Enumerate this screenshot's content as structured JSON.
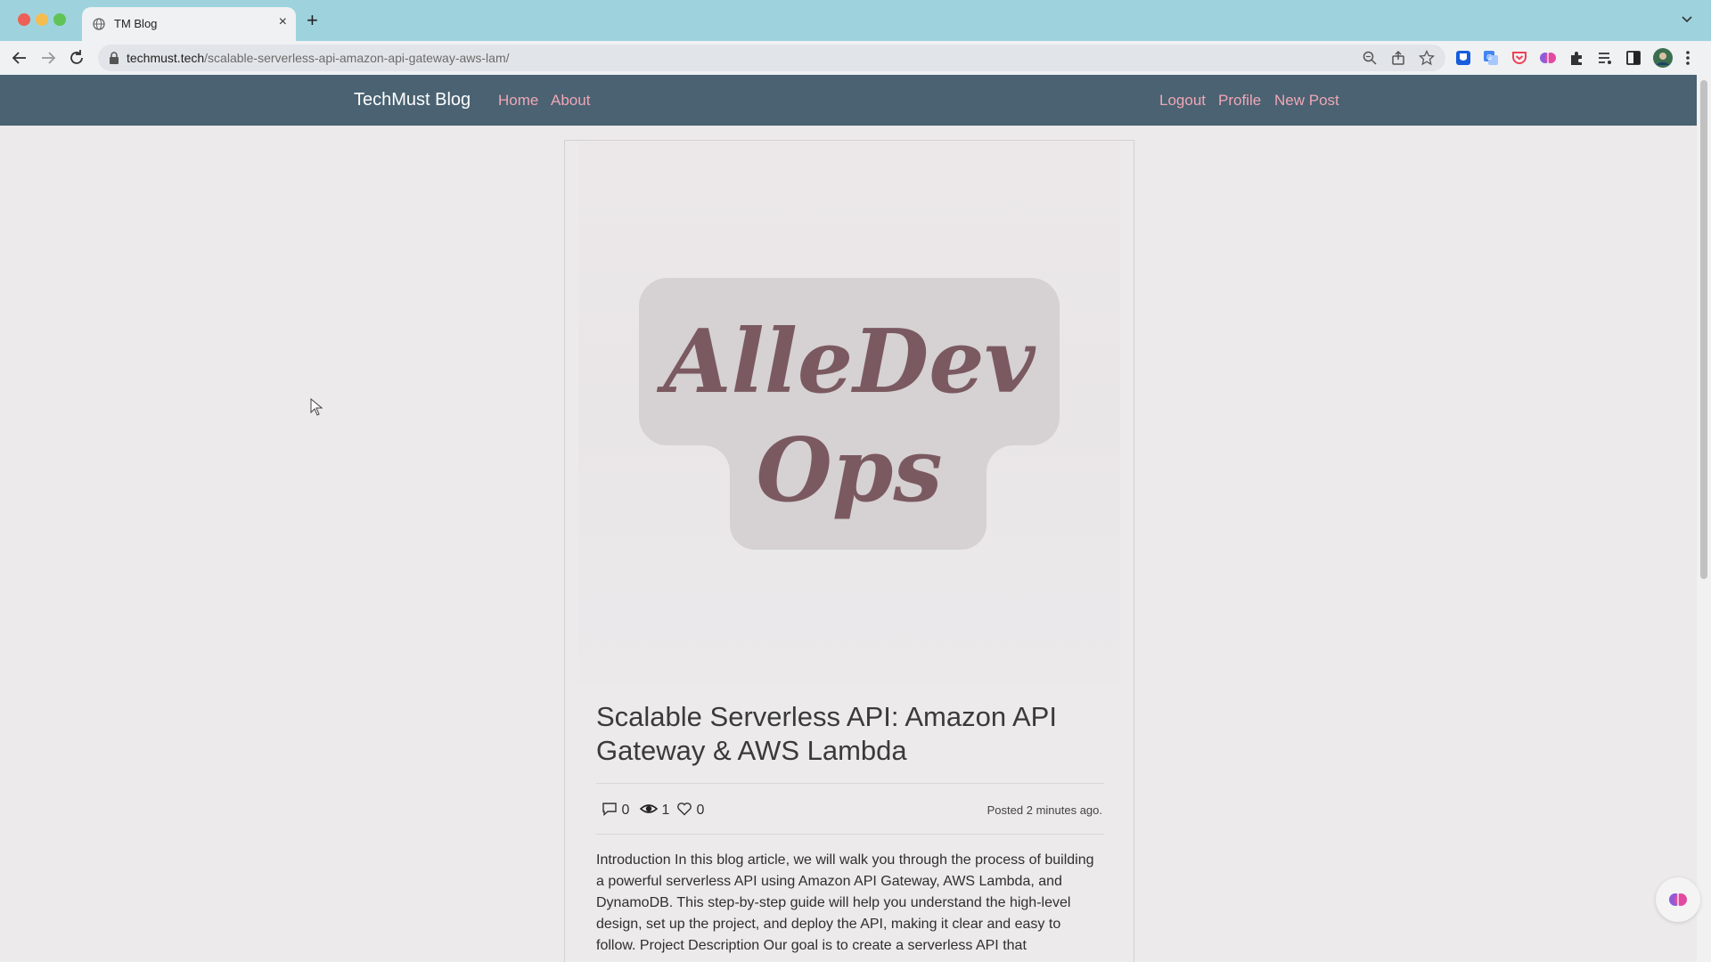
{
  "browser": {
    "tab_title": "TM Blog",
    "tab_close": "×",
    "new_tab": "+",
    "url_host": "techmust.tech",
    "url_path": "/scalable-serverless-api-amazon-api-gateway-aws-lam/",
    "toolbar_icons": [
      "back-icon",
      "forward-icon",
      "reload-icon",
      "lock-icon",
      "zoom-icon",
      "share-icon",
      "bookmark-star-icon"
    ],
    "extension_icons": [
      "bitwarden-icon",
      "translate-icon",
      "pocket-icon",
      "brain-extension-icon",
      "puzzle-icon",
      "reading-list-icon",
      "side-panel-icon",
      "profile-avatar",
      "menu-icon"
    ]
  },
  "navbar": {
    "brand": "TechMust Blog",
    "links": [
      {
        "label": "Home"
      },
      {
        "label": "About"
      },
      {
        "label": "Logout"
      },
      {
        "label": "Profile"
      },
      {
        "label": "New Post"
      }
    ]
  },
  "post": {
    "cover_logo_text": [
      "AlleDev",
      "Ops"
    ],
    "title": "Scalable Serverless API: Amazon API Gateway & AWS Lambda",
    "comments": "0",
    "views": "1",
    "likes": "0",
    "posted": "Posted 2 minutes ago.",
    "body": "Introduction In this blog article, we will walk you through the process of building a powerful serverless API using Amazon API Gateway, AWS Lambda, and DynamoDB. This step-by-step guide will help you understand the high-level design, set up the project, and deploy the API, making it clear and easy to follow. Project Description Our goal is to create a serverless API that"
  },
  "colors": {
    "navbar_bg": "#4a6272",
    "nav_link": "#f0a7b6",
    "brand_text": "#ffffff",
    "tabstrip": "#9ed3dd",
    "logo_text": "#7a5a60"
  }
}
